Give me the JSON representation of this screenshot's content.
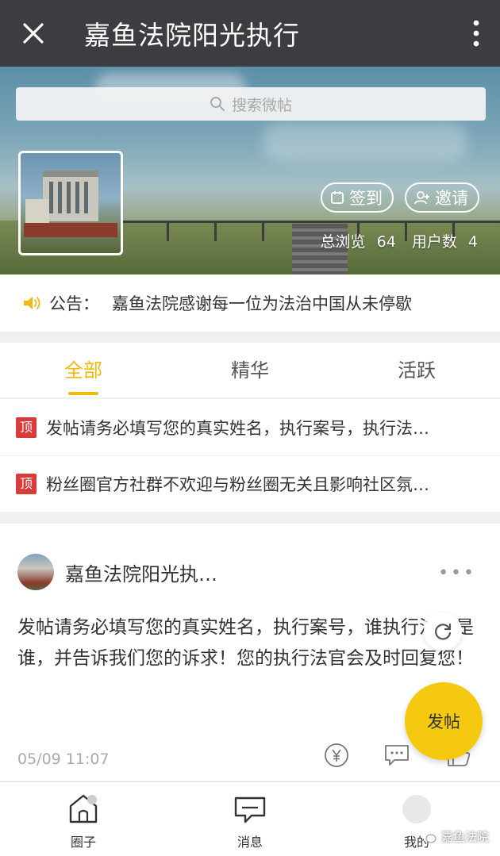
{
  "window": {
    "title": "嘉鱼法院阳光执行"
  },
  "search": {
    "placeholder": "搜索微帖"
  },
  "header": {
    "checkin_label": "签到",
    "invite_label": "邀请",
    "views_label": "总浏览",
    "views_count": "64",
    "users_label": "用户数",
    "users_count": "4"
  },
  "notice": {
    "label": "公告：",
    "text": "嘉鱼法院感谢每一位为法治中国从未停歇"
  },
  "tabs": [
    {
      "label": "全部",
      "active": true
    },
    {
      "label": "精华",
      "active": false
    },
    {
      "label": "活跃",
      "active": false
    }
  ],
  "pinned": {
    "badge": "顶",
    "items": [
      "发帖请务必填写您的真实姓名，执行案号，执行法…",
      "粉丝圈官方社群不欢迎与粉丝圈无关且影响社区氛…"
    ]
  },
  "post": {
    "author": "嘉鱼法院阳光执…",
    "body": "发帖请务必填写您的真实姓名，执行案号，谁执行法官是谁，并告诉我们您的诉求！您的执行法官会及时回复您！",
    "time": "05/09 11:07"
  },
  "fab": {
    "label": "发帖"
  },
  "bottom_nav": [
    {
      "label": "圈子",
      "icon": "home-icon"
    },
    {
      "label": "消息",
      "icon": "message-icon"
    },
    {
      "label": "我的",
      "icon": "profile-icon"
    }
  ],
  "watermark": {
    "text": "嘉鱼法院"
  },
  "colors": {
    "accent": "#f1b90e",
    "fab": "#f5c90f",
    "titlebar": "#3b3d41",
    "pin_badge": "#d93a3a"
  }
}
